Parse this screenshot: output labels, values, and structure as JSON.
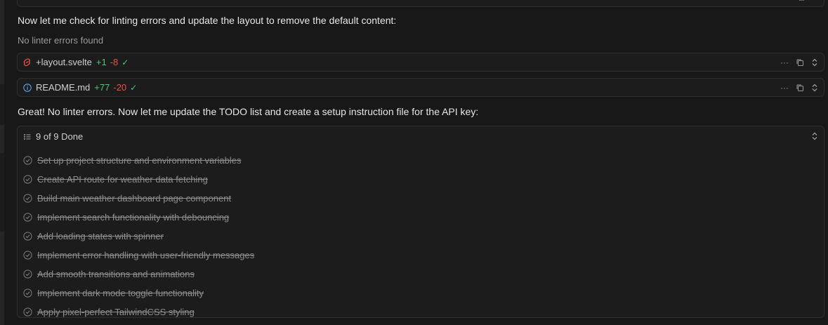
{
  "messages": {
    "check_lint": "Now let me check for linting errors and update the layout to remove the default content:",
    "no_lint": "No linter errors found",
    "great": "Great! No linter errors. Now let me update the TODO list and create a setup instruction file for the API key:"
  },
  "files": [
    {
      "name": "+layout.svelte",
      "added": "+1",
      "removed": "-8",
      "icon": "svelte-icon"
    },
    {
      "name": "README.md",
      "added": "+77",
      "removed": "-20",
      "icon": "info-icon"
    }
  ],
  "todo": {
    "title": "9 of 9 Done",
    "items": [
      "Set up project structure and environment variables",
      "Create API route for weather data fetching",
      "Build main weather dashboard page component",
      "Implement search functionality with debouncing",
      "Add loading states with spinner",
      "Implement error handling with user-friendly messages",
      "Add smooth transitions and animations",
      "Implement dark mode toggle functionality",
      "Apply pixel-perfect TailwindCSS styling"
    ]
  },
  "colors": {
    "added": "#4ec57a",
    "removed": "#e5534b",
    "svelte": "#e5534b",
    "info": "#5aa7e8"
  }
}
